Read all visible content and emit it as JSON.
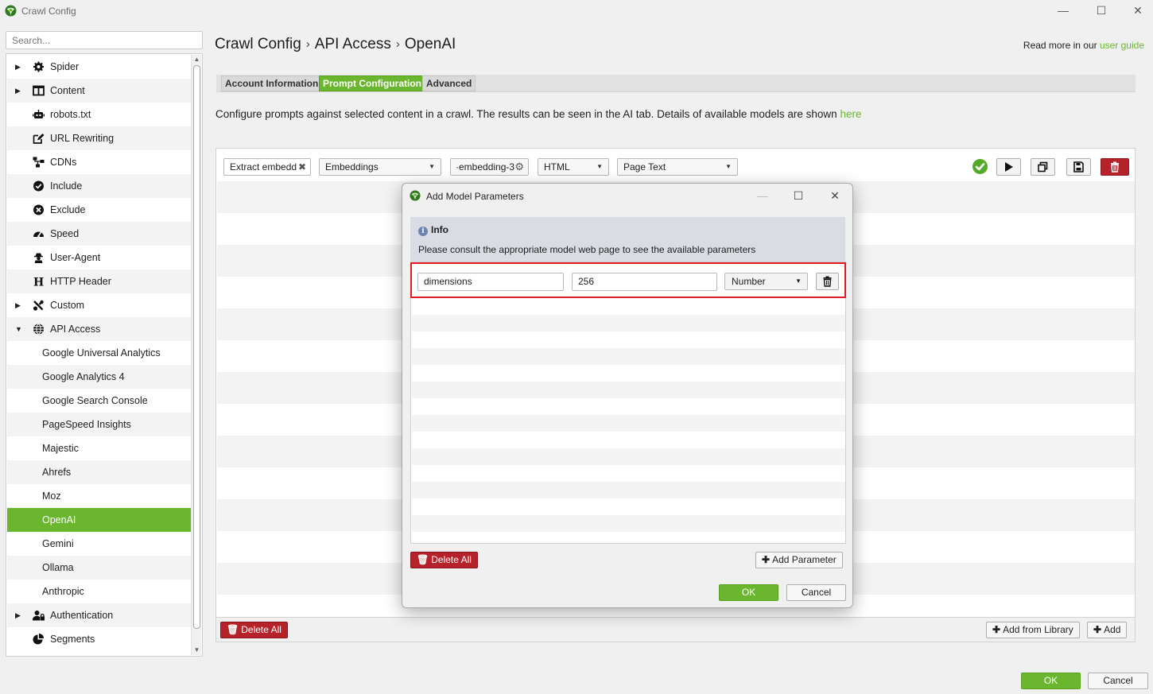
{
  "window": {
    "title": "Crawl Config",
    "minimize": "—",
    "maximize": "☐",
    "close": "✕"
  },
  "search": {
    "placeholder": "Search..."
  },
  "sidebar": {
    "items": [
      {
        "label": "Spider",
        "caret": "▶",
        "icon": "gear-icon"
      },
      {
        "label": "Content",
        "caret": "▶",
        "icon": "columns-icon"
      },
      {
        "label": "robots.txt",
        "caret": "",
        "icon": "robot-icon"
      },
      {
        "label": "URL Rewriting",
        "caret": "",
        "icon": "edit-icon"
      },
      {
        "label": "CDNs",
        "caret": "",
        "icon": "network-icon"
      },
      {
        "label": "Include",
        "caret": "",
        "icon": "check-circle-icon"
      },
      {
        "label": "Exclude",
        "caret": "",
        "icon": "x-circle-icon"
      },
      {
        "label": "Speed",
        "caret": "",
        "icon": "speedometer-icon"
      },
      {
        "label": "User-Agent",
        "caret": "",
        "icon": "user-secret-icon"
      },
      {
        "label": "HTTP Header",
        "caret": "",
        "icon": "header-h-icon"
      },
      {
        "label": "Custom",
        "caret": "▶",
        "icon": "tools-icon"
      },
      {
        "label": "API Access",
        "caret": "▼",
        "icon": "globe-icon"
      },
      {
        "label": "Google Universal Analytics"
      },
      {
        "label": "Google Analytics 4"
      },
      {
        "label": "Google Search Console"
      },
      {
        "label": "PageSpeed Insights"
      },
      {
        "label": "Majestic"
      },
      {
        "label": "Ahrefs"
      },
      {
        "label": "Moz"
      },
      {
        "label": "OpenAI"
      },
      {
        "label": "Gemini"
      },
      {
        "label": "Ollama"
      },
      {
        "label": "Anthropic"
      },
      {
        "label": "Authentication",
        "caret": "▶",
        "icon": "user-lock-icon"
      },
      {
        "label": "Segments",
        "caret": "",
        "icon": "pie-chart-icon"
      }
    ],
    "selected": "OpenAI",
    "scroll_up": "▲",
    "scroll_down": "▼"
  },
  "header": {
    "breadcrumb": [
      "Crawl Config",
      "API Access",
      "OpenAI"
    ],
    "separator": "›",
    "read_more_prefix": "Read more in our ",
    "read_more_link": "user guide"
  },
  "tabs": [
    {
      "label": "Account Information",
      "active": false
    },
    {
      "label": "Prompt Configuration",
      "active": true
    },
    {
      "label": "Advanced",
      "active": false
    }
  ],
  "description": {
    "text": "Configure prompts against selected content in a crawl. The results can be seen in the AI tab. Details of available models are shown ",
    "link": "here"
  },
  "prompt_row": {
    "name": "Extract embedd",
    "name_clear": "✖",
    "type": "Embeddings",
    "model": "·embedding-3",
    "model_gear": "⚙",
    "content_type": "HTML",
    "source": "Page Text",
    "dropdown_arrow": "▼"
  },
  "panel_footer": {
    "delete_all": "Delete All",
    "add_from_library": "Add from Library",
    "add": "Add",
    "plus": "✚"
  },
  "dialog": {
    "title": "Add Model Parameters",
    "minimize": "—",
    "maximize": "☐",
    "close": "✕",
    "info_heading": "Info",
    "info_icon": "i",
    "info_text": "Please consult the appropriate model web page to see the available parameters",
    "parameter": {
      "name": "dimensions",
      "value": "256",
      "type": "Number"
    },
    "delete_all": "Delete All",
    "add_parameter": "Add Parameter",
    "ok": "OK",
    "cancel": "Cancel"
  },
  "footer": {
    "ok": "OK",
    "cancel": "Cancel"
  },
  "colors": {
    "accent": "#6bb62f",
    "danger": "#b5222a",
    "highlight": "#e31b23",
    "info_bg": "#dadce3"
  }
}
